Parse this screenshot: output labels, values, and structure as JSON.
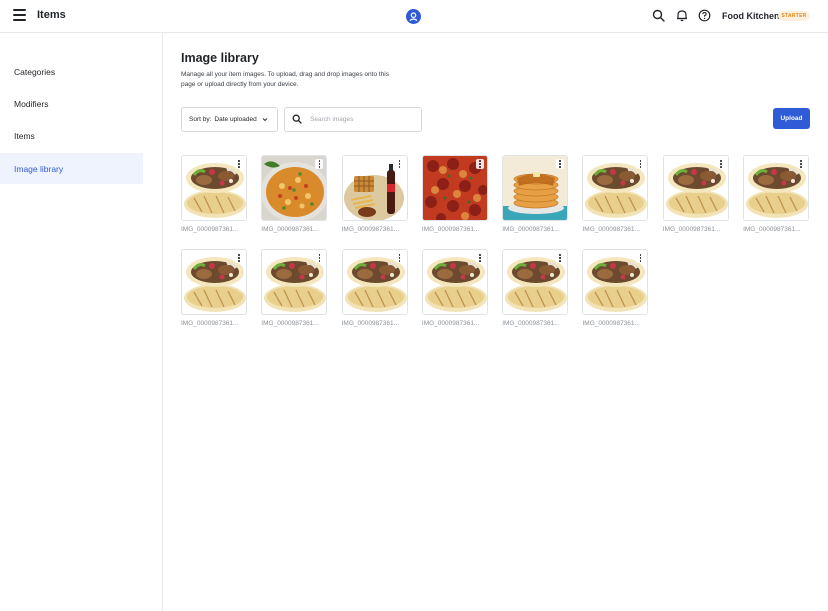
{
  "header": {
    "menu_icon": "hamburger-menu-icon",
    "title": "Items",
    "brand_icon": "brand-logo-icon",
    "search_icon": "search-icon",
    "notifications_icon": "bell-icon",
    "help_icon": "help-circle-icon",
    "store_name": "Food Kitchen",
    "plan_badge": "STARTER",
    "accent_color": "#2f5bd7",
    "badge_color": "#e08a1e"
  },
  "sidebar": {
    "items": [
      {
        "label": "Categories",
        "active": false
      },
      {
        "label": "Modifiers",
        "active": false
      },
      {
        "label": "Items",
        "active": false
      },
      {
        "label": "Image library",
        "active": true
      }
    ]
  },
  "main": {
    "title": "Image library",
    "description": "Manage all your item images. To upload, drag and drop images onto this page or upload directly from your device.",
    "sort": {
      "label": "Sort by:",
      "value": "Date uploaded",
      "icon": "chevron-down-icon"
    },
    "search": {
      "placeholder": "Search images",
      "value": "",
      "icon": "search-icon"
    },
    "upload_label": "Upload",
    "images": [
      {
        "filename": "IMG_0000987361...",
        "kind": "burrito"
      },
      {
        "filename": "IMG_0000987361...",
        "kind": "fried-rice"
      },
      {
        "filename": "IMG_0000987361...",
        "kind": "waffle-cola"
      },
      {
        "filename": "IMG_0000987361...",
        "kind": "pizza"
      },
      {
        "filename": "IMG_0000987361...",
        "kind": "pancakes"
      },
      {
        "filename": "IMG_0000987361...",
        "kind": "burrito"
      },
      {
        "filename": "IMG_0000987361...",
        "kind": "burrito"
      },
      {
        "filename": "IMG_0000987361...",
        "kind": "burrito"
      },
      {
        "filename": "IMG_0000987361...",
        "kind": "burrito"
      },
      {
        "filename": "IMG_0000987361...",
        "kind": "burrito"
      },
      {
        "filename": "IMG_0000987361...",
        "kind": "burrito"
      },
      {
        "filename": "IMG_0000987361...",
        "kind": "burrito"
      },
      {
        "filename": "IMG_0000987361...",
        "kind": "burrito"
      },
      {
        "filename": "IMG_0000987361...",
        "kind": "burrito"
      }
    ]
  }
}
